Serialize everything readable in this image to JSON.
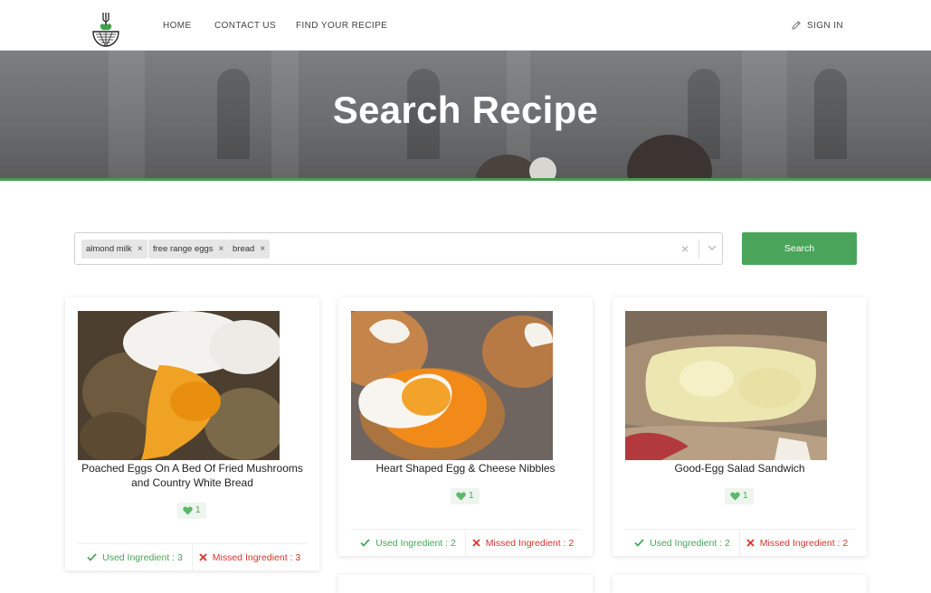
{
  "nav": {
    "home": "HOME",
    "contact": "CONTACT US",
    "find": "FIND YOUR RECIPE",
    "signin": "SIGN IN"
  },
  "hero": {
    "title": "Search Recipe"
  },
  "search": {
    "tags": [
      "almond milk",
      "free range eggs",
      "bread"
    ],
    "tag_remove_glyph": "×",
    "clear_glyph": "×",
    "button_label": "Search"
  },
  "recipes": [
    {
      "title": "Poached Eggs On A Bed Of Fried Mushrooms and Country White Bread",
      "likes": "1",
      "used": "Used Ingredient : 3",
      "missed": "Missed Ingredient : 3"
    },
    {
      "title": "Heart Shaped Egg & Cheese Nibbles",
      "likes": "1",
      "used": "Used Ingredient : 2",
      "missed": "Missed Ingredient : 2"
    },
    {
      "title": "Good-Egg Salad Sandwich",
      "likes": "1",
      "used": "Used Ingredient : 2",
      "missed": "Missed Ingredient : 2"
    }
  ],
  "icons": {
    "logo": "fork-bowl-logo-icon",
    "signin": "pencil-icon",
    "like": "heart-icon",
    "used": "check-icon",
    "missed": "cross-icon",
    "dropdown": "chevron-down-icon"
  },
  "colors": {
    "accent": "#4aa45a",
    "missed": "#d9342b",
    "hero_line": "#4a9a53"
  }
}
